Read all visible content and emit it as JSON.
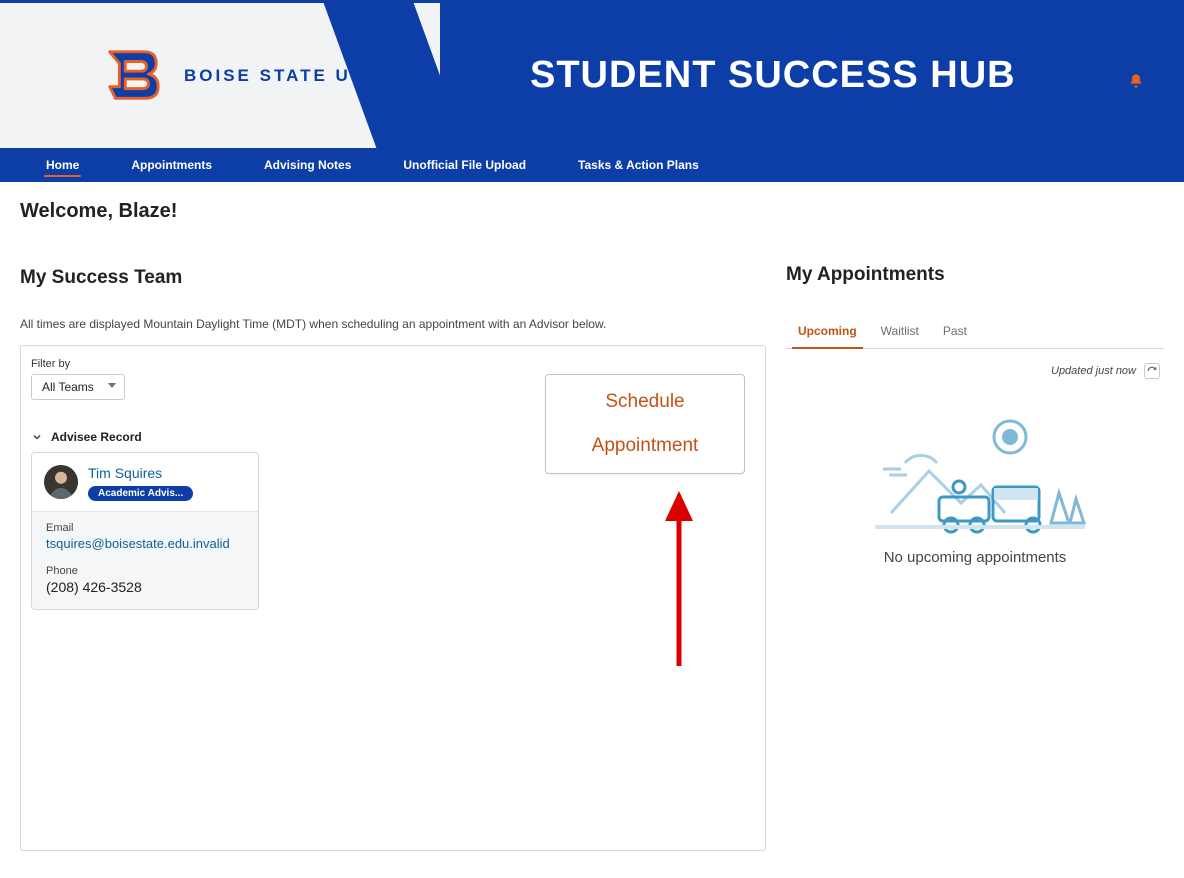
{
  "brand": {
    "university": "BOISE STATE UNIVERSITY",
    "app_title": "STUDENT SUCCESS HUB"
  },
  "nav": {
    "items": [
      {
        "label": "Home",
        "active": true
      },
      {
        "label": "Appointments",
        "active": false
      },
      {
        "label": "Advising Notes",
        "active": false
      },
      {
        "label": "Unofficial File Upload",
        "active": false
      },
      {
        "label": "Tasks & Action Plans",
        "active": false
      }
    ]
  },
  "welcome": "Welcome, Blaze!",
  "team": {
    "title": "My Success Team",
    "tz_note": "All times are displayed Mountain Daylight Time (MDT) when scheduling an appointment with an Advisor below.",
    "filter_label": "Filter by",
    "filter_value": "All Teams",
    "record_header": "Advisee Record",
    "advisor": {
      "name": "Tim Squires",
      "role_badge": "Academic Advis...",
      "email_label": "Email",
      "email": "tsquires@boisestate.edu.invalid",
      "phone_label": "Phone",
      "phone": "(208) 426-3528"
    },
    "schedule_button": {
      "line1": "Schedule",
      "line2": "Appointment"
    }
  },
  "appts": {
    "title": "My Appointments",
    "tabs": [
      {
        "label": "Upcoming",
        "active": true
      },
      {
        "label": "Waitlist",
        "active": false
      },
      {
        "label": "Past",
        "active": false
      }
    ],
    "updated": "Updated just now",
    "empty": "No upcoming appointments"
  }
}
